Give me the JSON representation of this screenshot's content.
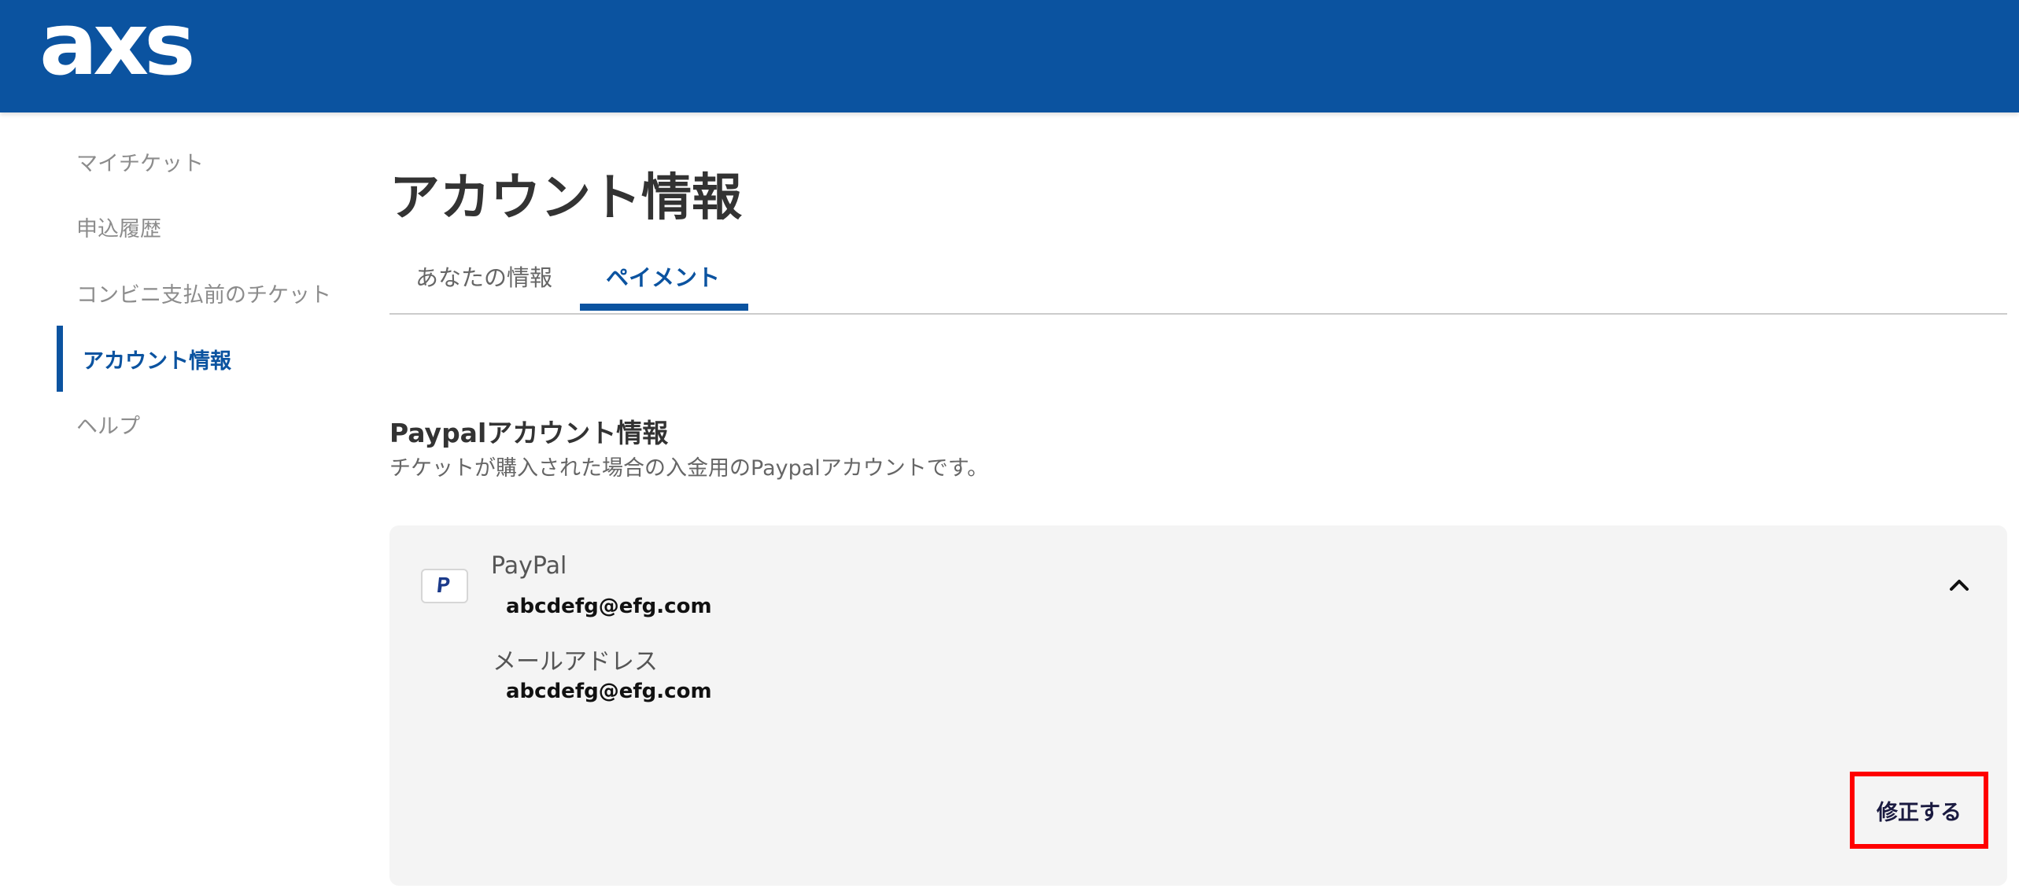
{
  "header": {
    "logo_text": "axs",
    "background": "#0b53a0"
  },
  "sidebar": {
    "items": [
      {
        "label": "マイチケット"
      },
      {
        "label": "申込履歴"
      },
      {
        "label": "コンビニ支払前のチケット"
      },
      {
        "label": "アカウント情報",
        "active": true
      },
      {
        "label": "ヘルプ"
      }
    ]
  },
  "main": {
    "title": "アカウント情報",
    "tabs": [
      {
        "label": "あなたの情報"
      },
      {
        "label": "ペイメント",
        "active": true
      }
    ],
    "section": {
      "title": "Paypalアカウント情報",
      "description": "チケットが購入された場合の入金用のPaypalアカウントです。"
    },
    "card": {
      "icon": "paypal-icon",
      "method_name": "PayPal",
      "method_value": "abcdefg@efg.com",
      "email_label": "メールアドレス",
      "email_value": "abcdefg@efg.com",
      "expanded": true,
      "edit_label": "修正する"
    }
  },
  "colors": {
    "accent": "#0b53a0",
    "card_bg": "#f4f4f4",
    "highlight": "#ff0000"
  }
}
